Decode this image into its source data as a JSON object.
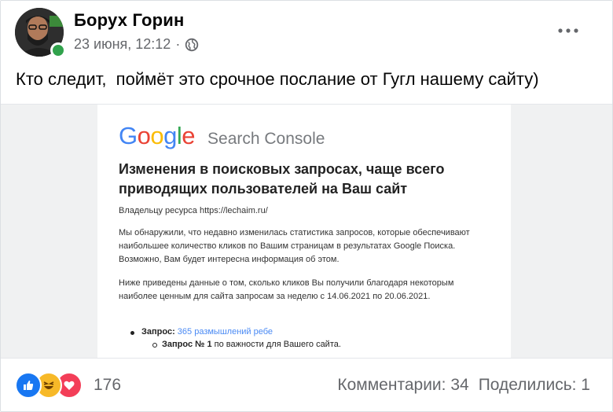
{
  "post": {
    "author": "Борух Горин",
    "date": "23 июня, 12:12",
    "separator": "·",
    "privacy_icon": "globe-icon",
    "more_icon": "more-options-icon",
    "text": "Кто следит,  поймёт это срочное послание от Гугл нашему сайту)"
  },
  "image": {
    "logo": [
      "G",
      "o",
      "o",
      "g",
      "l",
      "e"
    ],
    "product": "Search Console",
    "headline": "Изменения в поисковых запросах, чаще всего приводящих пользователей на Ваш сайт",
    "owner_prefix": "Владельцу ресурса ",
    "owner_url": "https://lechaim.ru/",
    "para1": "Мы обнаружили, что недавно изменилась статистика запросов, которые обеспечивают наибольшее количество кликов по Вашим страницам в результатах Google Поиска. Возможно, Вам будет интересна информация об этом.",
    "para2": "Ниже приведены данные о том, сколько кликов Вы получили благодаря некоторым наиболее ценным для сайта запросам за неделю с 14.06.2021 по 20.06.2021.",
    "query_label": "Запрос:",
    "query_value": "365 размышлений ребе",
    "rank_label": "Запрос № 1",
    "rank_text": " по важности для Вашего сайта."
  },
  "footer": {
    "reaction_icons": [
      "like-reaction-icon",
      "haha-reaction-icon",
      "love-reaction-icon"
    ],
    "reaction_count": "176",
    "comments": "Комментарии: 34",
    "shares": "Поделились: 1"
  },
  "colors": {
    "like": "#1877f2",
    "haha": "#f7b928",
    "love": "#f33e58",
    "online": "#31a24c"
  }
}
